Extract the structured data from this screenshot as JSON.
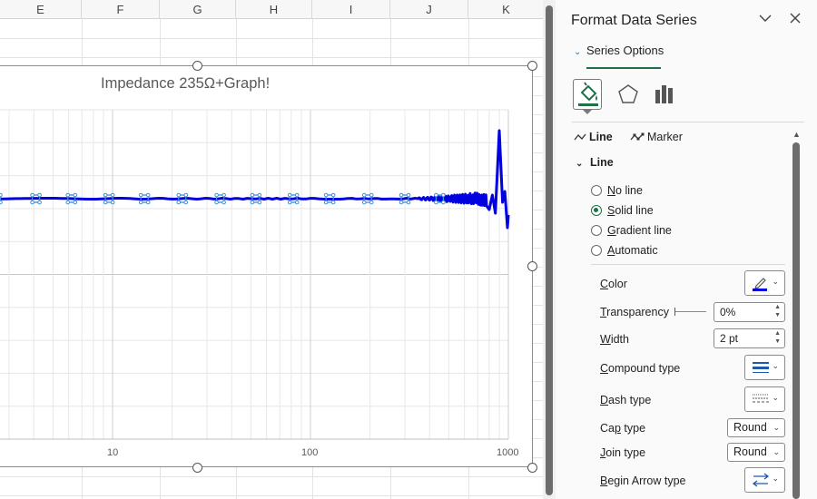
{
  "sheet": {
    "columns": [
      "E",
      "F",
      "G",
      "H",
      "I",
      "J",
      "K"
    ]
  },
  "chart": {
    "title": "Impedance 235Ω+Graph!",
    "x_ticks": [
      "10",
      "100",
      "1000"
    ]
  },
  "chart_data": {
    "type": "line",
    "title": "Impedance 235Ω+Graph!",
    "x_scale": "log",
    "x_tick_labels": [
      "10",
      "100",
      "1000"
    ],
    "visible_x_range": [
      1.5,
      1000
    ],
    "series": [
      {
        "color": "#0000e0",
        "marker_x": [
          2.6,
          4.1,
          6.2,
          9.6,
          14.5,
          22.5,
          35,
          53,
          82,
          125,
          195,
          300,
          450
        ],
        "description_values": "flat line with rising oscillations near 400-1000 and a sharp spike near 900"
      }
    ]
  },
  "pane": {
    "title": "Format Data Series",
    "tab": "Series Options",
    "subtabs": {
      "line": "Line",
      "marker": "Marker"
    },
    "section": "Line",
    "radios": [
      {
        "label": "No line",
        "accel": "N",
        "rest": "o line"
      },
      {
        "label": "Solid line",
        "accel": "S",
        "rest": "olid line"
      },
      {
        "label": "Gradient line",
        "accel": "G",
        "rest": "radient line"
      },
      {
        "label": "Automatic",
        "accel": "A",
        "rest": "utomatic"
      }
    ],
    "props": {
      "color": {
        "accel": "C",
        "rest": "olor",
        "swatch": "#0000e0"
      },
      "transparency": {
        "accel": "T",
        "rest": "ransparency",
        "value": "0%"
      },
      "width": {
        "accel": "W",
        "rest": "idth",
        "value": "2 pt"
      },
      "compound": {
        "accel": "C",
        "rest": "ompound type"
      },
      "dash": {
        "accel": "D",
        "rest": "ash type"
      },
      "cap": {
        "pre": "Ca",
        "accel": "p",
        "rest": " type",
        "value": "Round"
      },
      "join": {
        "accel": "J",
        "rest": "oin type",
        "value": "Round"
      },
      "begin_arrow": {
        "accel": "B",
        "rest": "egin Arrow type"
      }
    },
    "colors": {
      "accent_green": "#1e7145",
      "series_blue": "#0000e0"
    }
  }
}
